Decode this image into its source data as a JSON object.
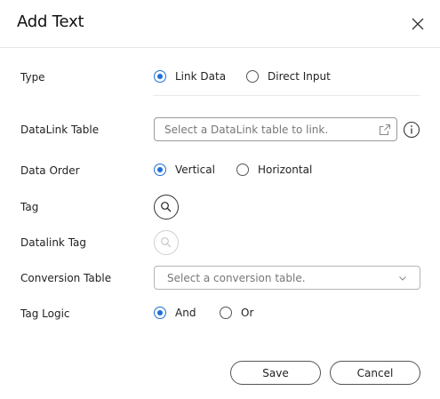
{
  "dialog": {
    "title": "Add Text"
  },
  "form": {
    "type": {
      "label": "Type",
      "options": [
        "Link Data",
        "Direct Input"
      ],
      "selected": "Link Data"
    },
    "datalink_table": {
      "label": "DataLink Table",
      "placeholder": "Select a DataLink table to link."
    },
    "data_order": {
      "label": "Data Order",
      "options": [
        "Vertical",
        "Horizontal"
      ],
      "selected": "Vertical"
    },
    "tag": {
      "label": "Tag"
    },
    "datalink_tag": {
      "label": "Datalink Tag"
    },
    "conversion_table": {
      "label": "Conversion Table",
      "placeholder": "Select a conversion table."
    },
    "tag_logic": {
      "label": "Tag Logic",
      "options": [
        "And",
        "Or"
      ],
      "selected": "And"
    }
  },
  "footer": {
    "save_label": "Save",
    "cancel_label": "Cancel"
  },
  "colors": {
    "accent": "#1e6fd9",
    "border": "#9a9a9a",
    "separator": "#e6e6e6"
  },
  "icons": {
    "close": "close-icon",
    "external_link": "external-link-icon",
    "info": "info-icon",
    "search": "search-icon",
    "dropdown": "chevron-down-icon"
  }
}
